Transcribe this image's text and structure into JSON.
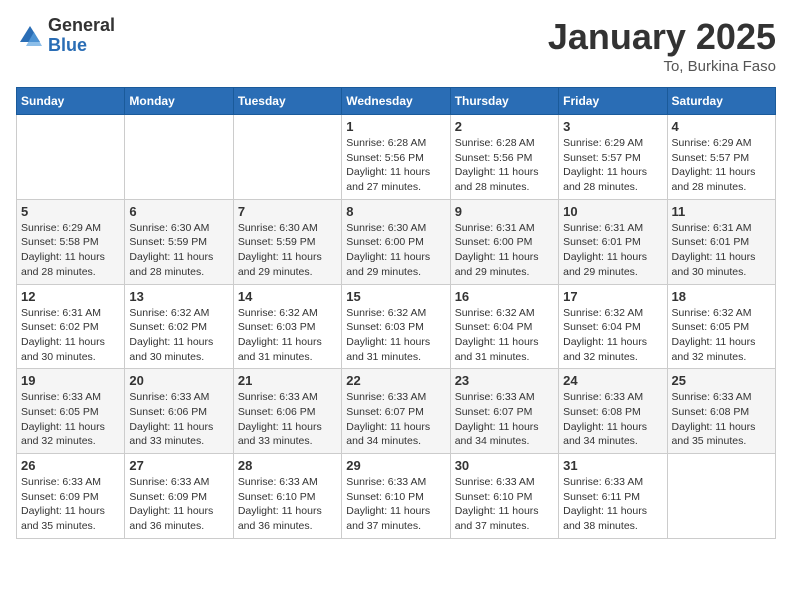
{
  "header": {
    "logo_general": "General",
    "logo_blue": "Blue",
    "month_title": "January 2025",
    "location": "To, Burkina Faso"
  },
  "days_of_week": [
    "Sunday",
    "Monday",
    "Tuesday",
    "Wednesday",
    "Thursday",
    "Friday",
    "Saturday"
  ],
  "weeks": [
    [
      {
        "day": "",
        "info": ""
      },
      {
        "day": "",
        "info": ""
      },
      {
        "day": "",
        "info": ""
      },
      {
        "day": "1",
        "info": "Sunrise: 6:28 AM\nSunset: 5:56 PM\nDaylight: 11 hours and 27 minutes."
      },
      {
        "day": "2",
        "info": "Sunrise: 6:28 AM\nSunset: 5:56 PM\nDaylight: 11 hours and 28 minutes."
      },
      {
        "day": "3",
        "info": "Sunrise: 6:29 AM\nSunset: 5:57 PM\nDaylight: 11 hours and 28 minutes."
      },
      {
        "day": "4",
        "info": "Sunrise: 6:29 AM\nSunset: 5:57 PM\nDaylight: 11 hours and 28 minutes."
      }
    ],
    [
      {
        "day": "5",
        "info": "Sunrise: 6:29 AM\nSunset: 5:58 PM\nDaylight: 11 hours and 28 minutes."
      },
      {
        "day": "6",
        "info": "Sunrise: 6:30 AM\nSunset: 5:59 PM\nDaylight: 11 hours and 28 minutes."
      },
      {
        "day": "7",
        "info": "Sunrise: 6:30 AM\nSunset: 5:59 PM\nDaylight: 11 hours and 29 minutes."
      },
      {
        "day": "8",
        "info": "Sunrise: 6:30 AM\nSunset: 6:00 PM\nDaylight: 11 hours and 29 minutes."
      },
      {
        "day": "9",
        "info": "Sunrise: 6:31 AM\nSunset: 6:00 PM\nDaylight: 11 hours and 29 minutes."
      },
      {
        "day": "10",
        "info": "Sunrise: 6:31 AM\nSunset: 6:01 PM\nDaylight: 11 hours and 29 minutes."
      },
      {
        "day": "11",
        "info": "Sunrise: 6:31 AM\nSunset: 6:01 PM\nDaylight: 11 hours and 30 minutes."
      }
    ],
    [
      {
        "day": "12",
        "info": "Sunrise: 6:31 AM\nSunset: 6:02 PM\nDaylight: 11 hours and 30 minutes."
      },
      {
        "day": "13",
        "info": "Sunrise: 6:32 AM\nSunset: 6:02 PM\nDaylight: 11 hours and 30 minutes."
      },
      {
        "day": "14",
        "info": "Sunrise: 6:32 AM\nSunset: 6:03 PM\nDaylight: 11 hours and 31 minutes."
      },
      {
        "day": "15",
        "info": "Sunrise: 6:32 AM\nSunset: 6:03 PM\nDaylight: 11 hours and 31 minutes."
      },
      {
        "day": "16",
        "info": "Sunrise: 6:32 AM\nSunset: 6:04 PM\nDaylight: 11 hours and 31 minutes."
      },
      {
        "day": "17",
        "info": "Sunrise: 6:32 AM\nSunset: 6:04 PM\nDaylight: 11 hours and 32 minutes."
      },
      {
        "day": "18",
        "info": "Sunrise: 6:32 AM\nSunset: 6:05 PM\nDaylight: 11 hours and 32 minutes."
      }
    ],
    [
      {
        "day": "19",
        "info": "Sunrise: 6:33 AM\nSunset: 6:05 PM\nDaylight: 11 hours and 32 minutes."
      },
      {
        "day": "20",
        "info": "Sunrise: 6:33 AM\nSunset: 6:06 PM\nDaylight: 11 hours and 33 minutes."
      },
      {
        "day": "21",
        "info": "Sunrise: 6:33 AM\nSunset: 6:06 PM\nDaylight: 11 hours and 33 minutes."
      },
      {
        "day": "22",
        "info": "Sunrise: 6:33 AM\nSunset: 6:07 PM\nDaylight: 11 hours and 34 minutes."
      },
      {
        "day": "23",
        "info": "Sunrise: 6:33 AM\nSunset: 6:07 PM\nDaylight: 11 hours and 34 minutes."
      },
      {
        "day": "24",
        "info": "Sunrise: 6:33 AM\nSunset: 6:08 PM\nDaylight: 11 hours and 34 minutes."
      },
      {
        "day": "25",
        "info": "Sunrise: 6:33 AM\nSunset: 6:08 PM\nDaylight: 11 hours and 35 minutes."
      }
    ],
    [
      {
        "day": "26",
        "info": "Sunrise: 6:33 AM\nSunset: 6:09 PM\nDaylight: 11 hours and 35 minutes."
      },
      {
        "day": "27",
        "info": "Sunrise: 6:33 AM\nSunset: 6:09 PM\nDaylight: 11 hours and 36 minutes."
      },
      {
        "day": "28",
        "info": "Sunrise: 6:33 AM\nSunset: 6:10 PM\nDaylight: 11 hours and 36 minutes."
      },
      {
        "day": "29",
        "info": "Sunrise: 6:33 AM\nSunset: 6:10 PM\nDaylight: 11 hours and 37 minutes."
      },
      {
        "day": "30",
        "info": "Sunrise: 6:33 AM\nSunset: 6:10 PM\nDaylight: 11 hours and 37 minutes."
      },
      {
        "day": "31",
        "info": "Sunrise: 6:33 AM\nSunset: 6:11 PM\nDaylight: 11 hours and 38 minutes."
      },
      {
        "day": "",
        "info": ""
      }
    ]
  ]
}
